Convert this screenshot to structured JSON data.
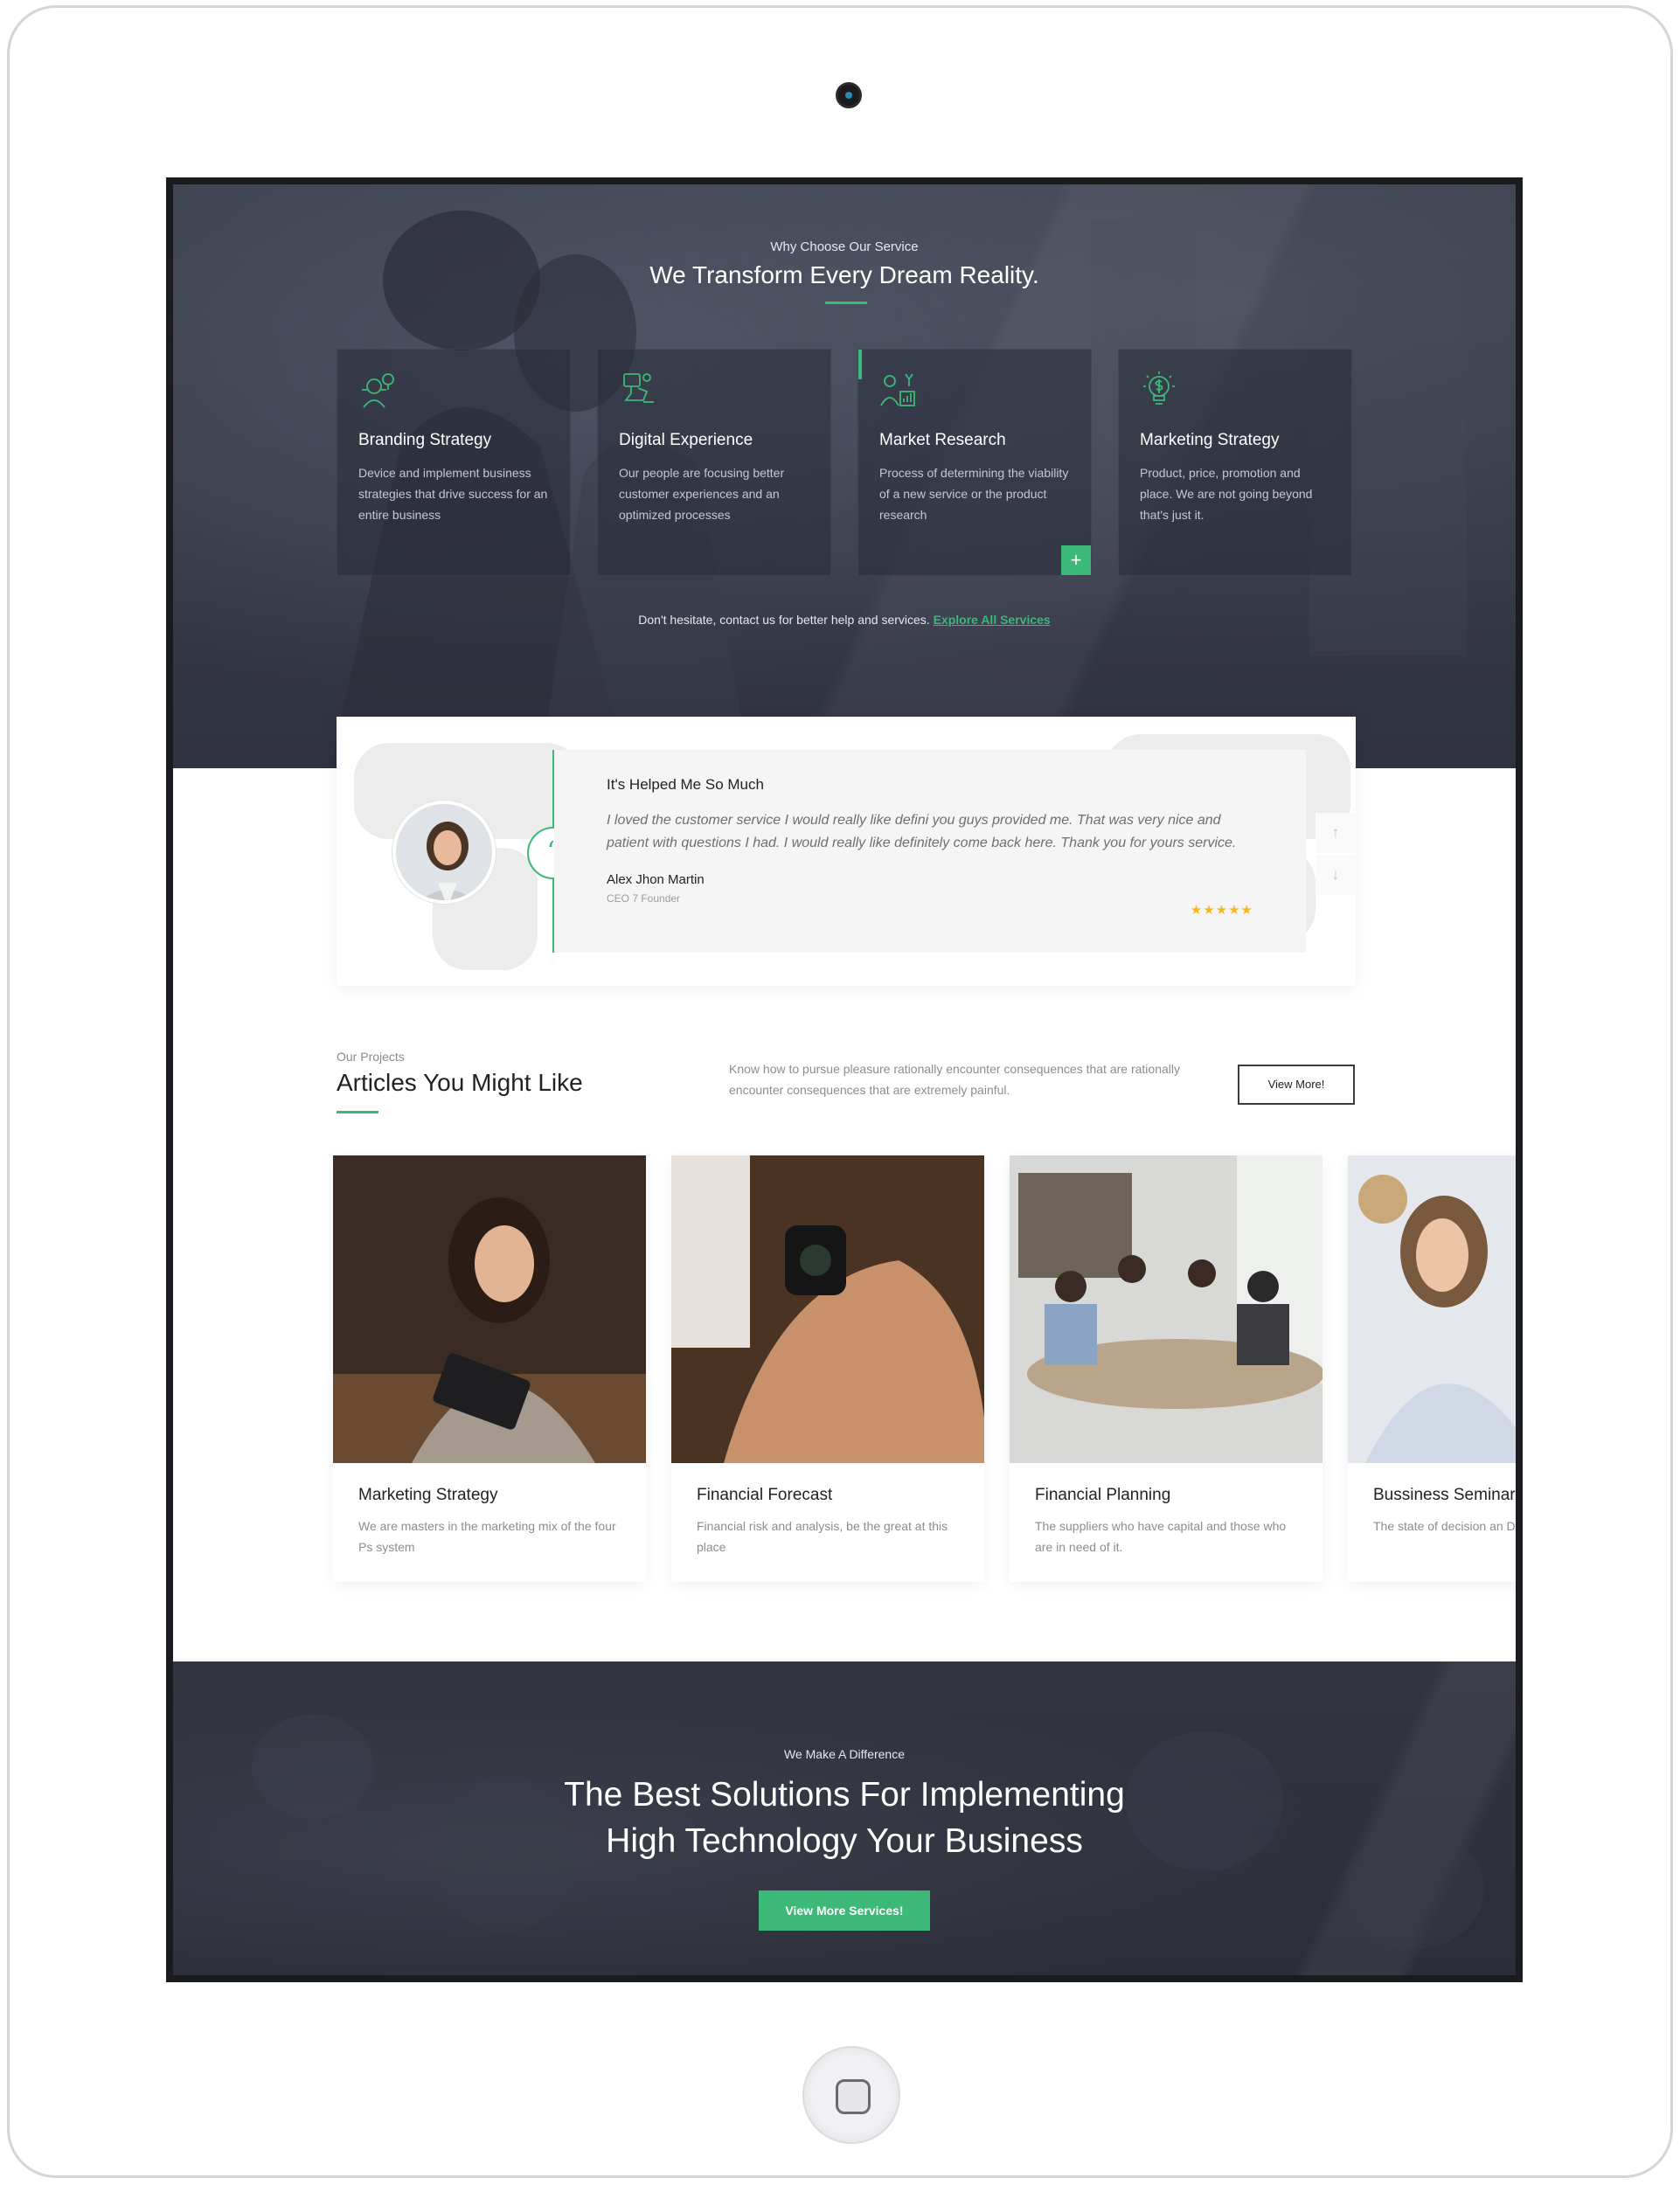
{
  "hero": {
    "eyebrow": "Why Choose Our Service",
    "title": "We Transform Every Dream Reality.",
    "services": [
      {
        "title": "Branding Strategy",
        "desc": "Device and implement business strategies that drive success for an entire business",
        "icon": "strategy-person-icon"
      },
      {
        "title": "Digital Experience",
        "desc": "Our people are focusing better customer experiences and an optimized processes",
        "icon": "digital-hand-icon"
      },
      {
        "title": "Market Research",
        "desc": "Process of determining the viability of a new service or the product research",
        "icon": "market-chart-icon"
      },
      {
        "title": "Marketing Strategy",
        "desc": "Product, price, promotion and place. We are not going beyond that's just it.",
        "icon": "dollar-bulb-icon"
      }
    ],
    "footer_text": "Don't hesitate, contact us for better help and services.",
    "footer_link": "Explore All Services"
  },
  "testimonial": {
    "title": "It's Helped Me So Much",
    "text": "I loved the customer service I would really like defini you guys provided me. That was very nice and patient with questions I had. I would really like definitely come back here. Thank you for yours service.",
    "name": "Alex Jhon Martin",
    "role": "CEO 7 Founder",
    "stars": "★★★★★",
    "rating": 5
  },
  "projects": {
    "eyebrow": "Our Projects",
    "title": "Articles You Might Like",
    "desc": "Know how to pursue pleasure rationally encounter consequences that are rationally encounter consequences that are extremely painful.",
    "button": "View More!",
    "articles": [
      {
        "title": "Marketing Strategy",
        "desc": "We are masters in the marketing mix of the four Ps system"
      },
      {
        "title": "Financial Forecast",
        "desc": "Financial risk and analysis, be the great at this place"
      },
      {
        "title": "Financial Planning",
        "desc": "The suppliers who have capital and those who are in need of it."
      },
      {
        "title": "Bussiness Seminar",
        "desc": "The state of decision an Designed decision algo"
      }
    ]
  },
  "cta": {
    "eyebrow": "We Make A Difference",
    "title_line1": "The Best Solutions For Implementing",
    "title_line2": "High Technology Your Business",
    "button": "View More Services!"
  },
  "colors": {
    "accent": "#3cb878",
    "dark": "#353846",
    "star": "#f4b91a"
  }
}
